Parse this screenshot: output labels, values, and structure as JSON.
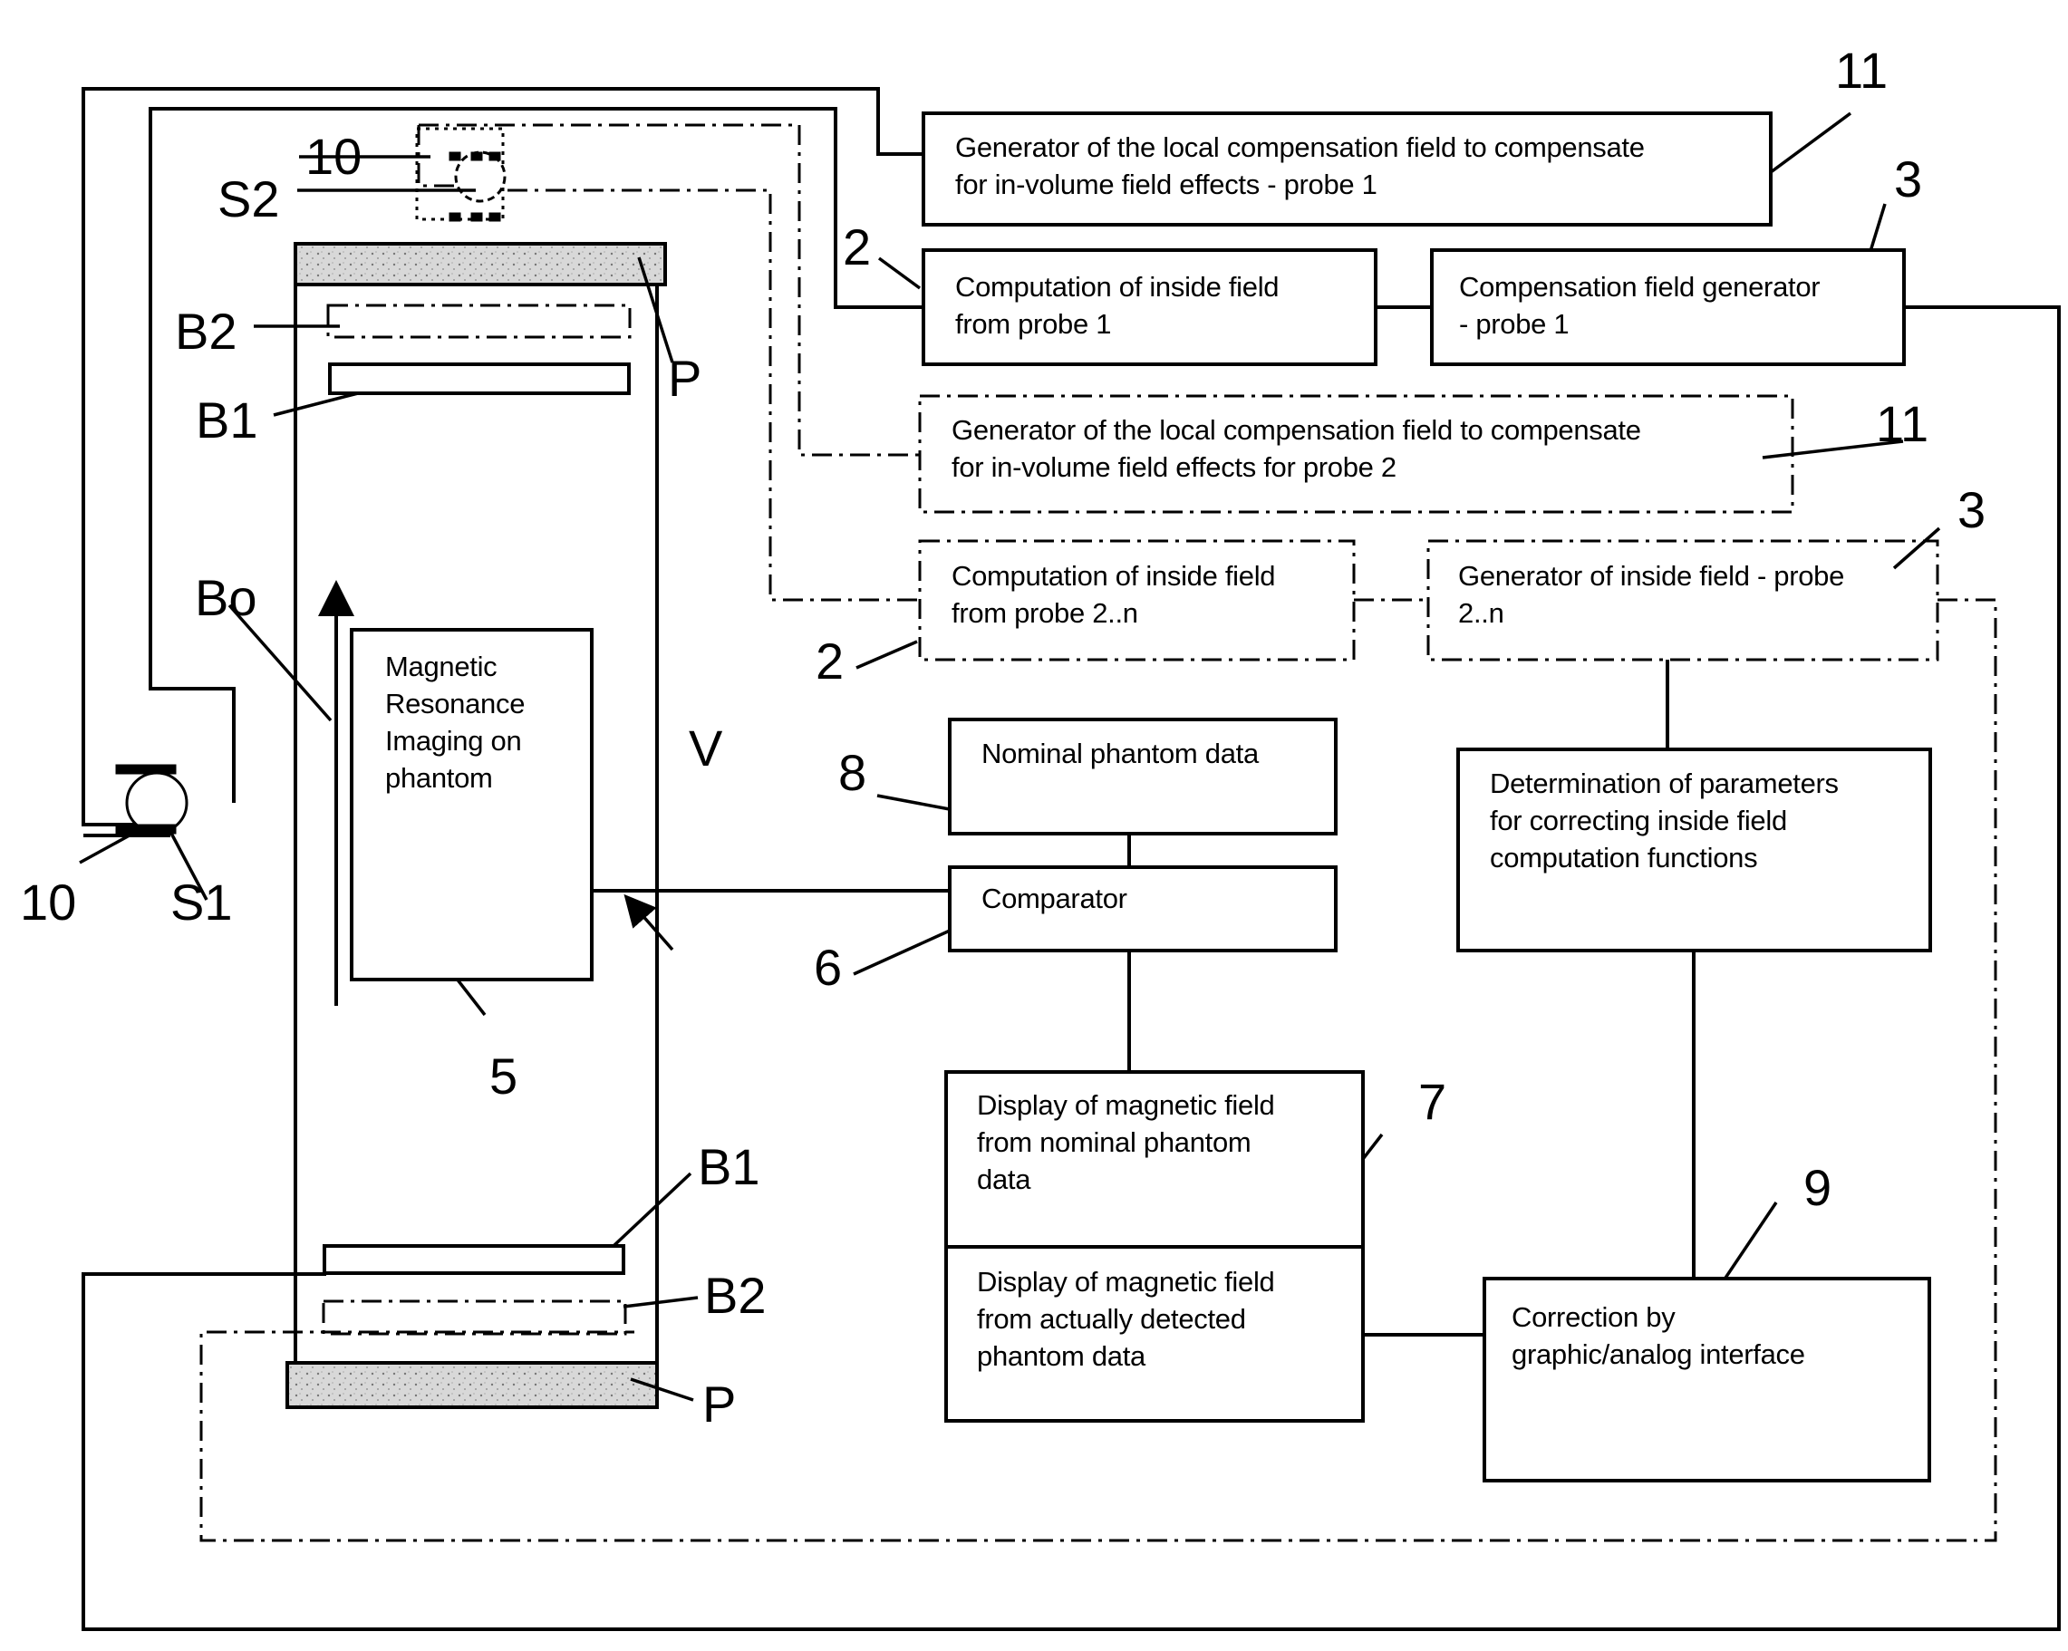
{
  "diagram": {
    "type": "block diagram - magnetic field compensation with phantom calibration",
    "boxes": {
      "gen_local_comp_probe1": "Generator of the local compensation field to compensate\nfor in-volume field effects - probe 1",
      "computation_probe1": "Computation of inside field\nfrom probe 1",
      "comp_field_gen_probe1": "Compensation field generator\n- probe 1",
      "gen_local_comp_probe2": "Generator of the local compensation field to compensate\nfor in-volume field effects for probe 2",
      "computation_probe2n": "Computation of inside field\nfrom probe 2..n",
      "gen_inside_field_probe2n": "Generator of inside field - probe\n2..n",
      "nominal_phantom": "Nominal phantom data",
      "comparator": "Comparator",
      "determination": "Determination of parameters\nfor correcting inside field\ncomputation functions",
      "display_nominal": "Display of magnetic field\nfrom nominal phantom\ndata",
      "display_detected": "Display of magnetic field\nfrom actually detected\nphantom data",
      "correction": "Correction by\ngraphic/analog interface",
      "mri": "Magnetic\nResonance\nImaging on\nphantom"
    },
    "labels": {
      "ref_11_top": "11",
      "ref_3_top": "3",
      "ref_2_top": "2",
      "ref_11_mid": "11",
      "ref_3_mid": "3",
      "ref_2_mid": "2",
      "ref_10_top": "10",
      "ref_s2": "S2",
      "ref_b2_top": "B2",
      "ref_b1_top": "B1",
      "ref_p_top": "P",
      "ref_bo": "Bo",
      "ref_v": "V",
      "ref_8": "8",
      "ref_6": "6",
      "ref_5": "5",
      "ref_7": "7",
      "ref_9": "9",
      "ref_10_bottom": "10",
      "ref_s1": "S1",
      "ref_b1_bottom": "B1",
      "ref_b2_bottom": "B2",
      "ref_p_bottom": "P"
    }
  }
}
